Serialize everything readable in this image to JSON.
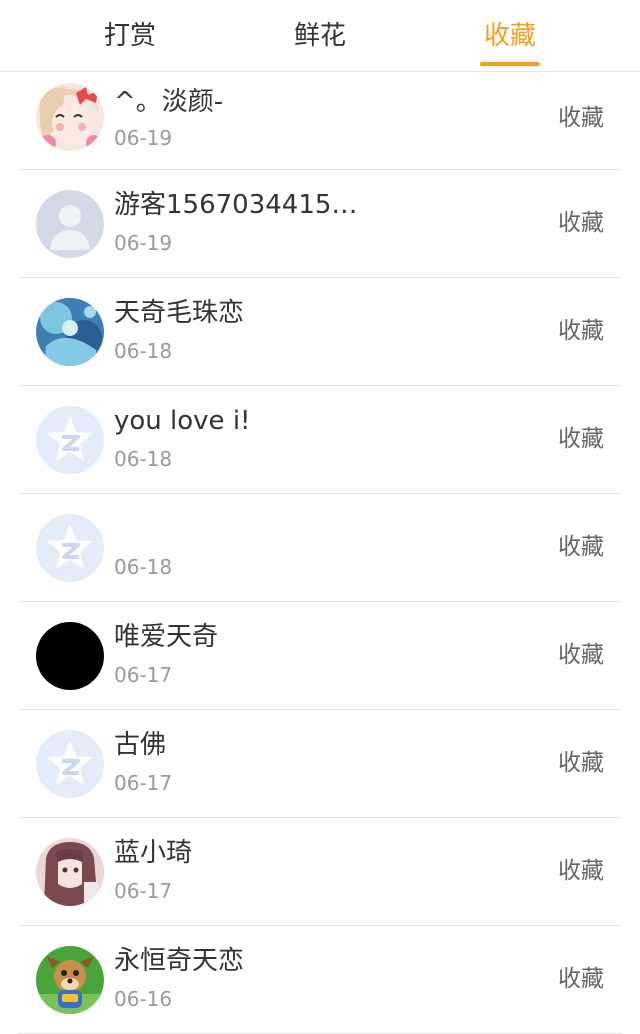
{
  "tabs": [
    {
      "label": "打赏",
      "active": false
    },
    {
      "label": "鲜花",
      "active": false
    },
    {
      "label": "收藏",
      "active": true
    }
  ],
  "colors": {
    "accent": "#f0a020",
    "text_primary": "#333333",
    "text_secondary": "#9a9a9a",
    "divider": "#e8e8e8"
  },
  "list": [
    {
      "name": "^。淡颜-",
      "date": "06-19",
      "action": "收藏",
      "avatar": "anime-girl-bow-avatar"
    },
    {
      "name": "游客1567034415…",
      "date": "06-19",
      "action": "收藏",
      "avatar": "default-person-avatar"
    },
    {
      "name": "天奇毛珠恋",
      "date": "06-18",
      "action": "收藏",
      "avatar": "blue-anime-avatar"
    },
    {
      "name": "you love i!",
      "date": "06-18",
      "action": "收藏",
      "avatar": "qzone-star-avatar"
    },
    {
      "name": "",
      "date": "06-18",
      "action": "收藏",
      "avatar": "qzone-star-avatar"
    },
    {
      "name": "唯爱天奇",
      "date": "06-17",
      "action": "收藏",
      "avatar": "black-avatar"
    },
    {
      "name": "古佛",
      "date": "06-17",
      "action": "收藏",
      "avatar": "qzone-star-avatar"
    },
    {
      "name": "蓝小琦",
      "date": "06-17",
      "action": "收藏",
      "avatar": "anime-long-hair-avatar"
    },
    {
      "name": "永恒奇天恋",
      "date": "06-16",
      "action": "收藏",
      "avatar": "cartoon-dog-avatar"
    }
  ]
}
